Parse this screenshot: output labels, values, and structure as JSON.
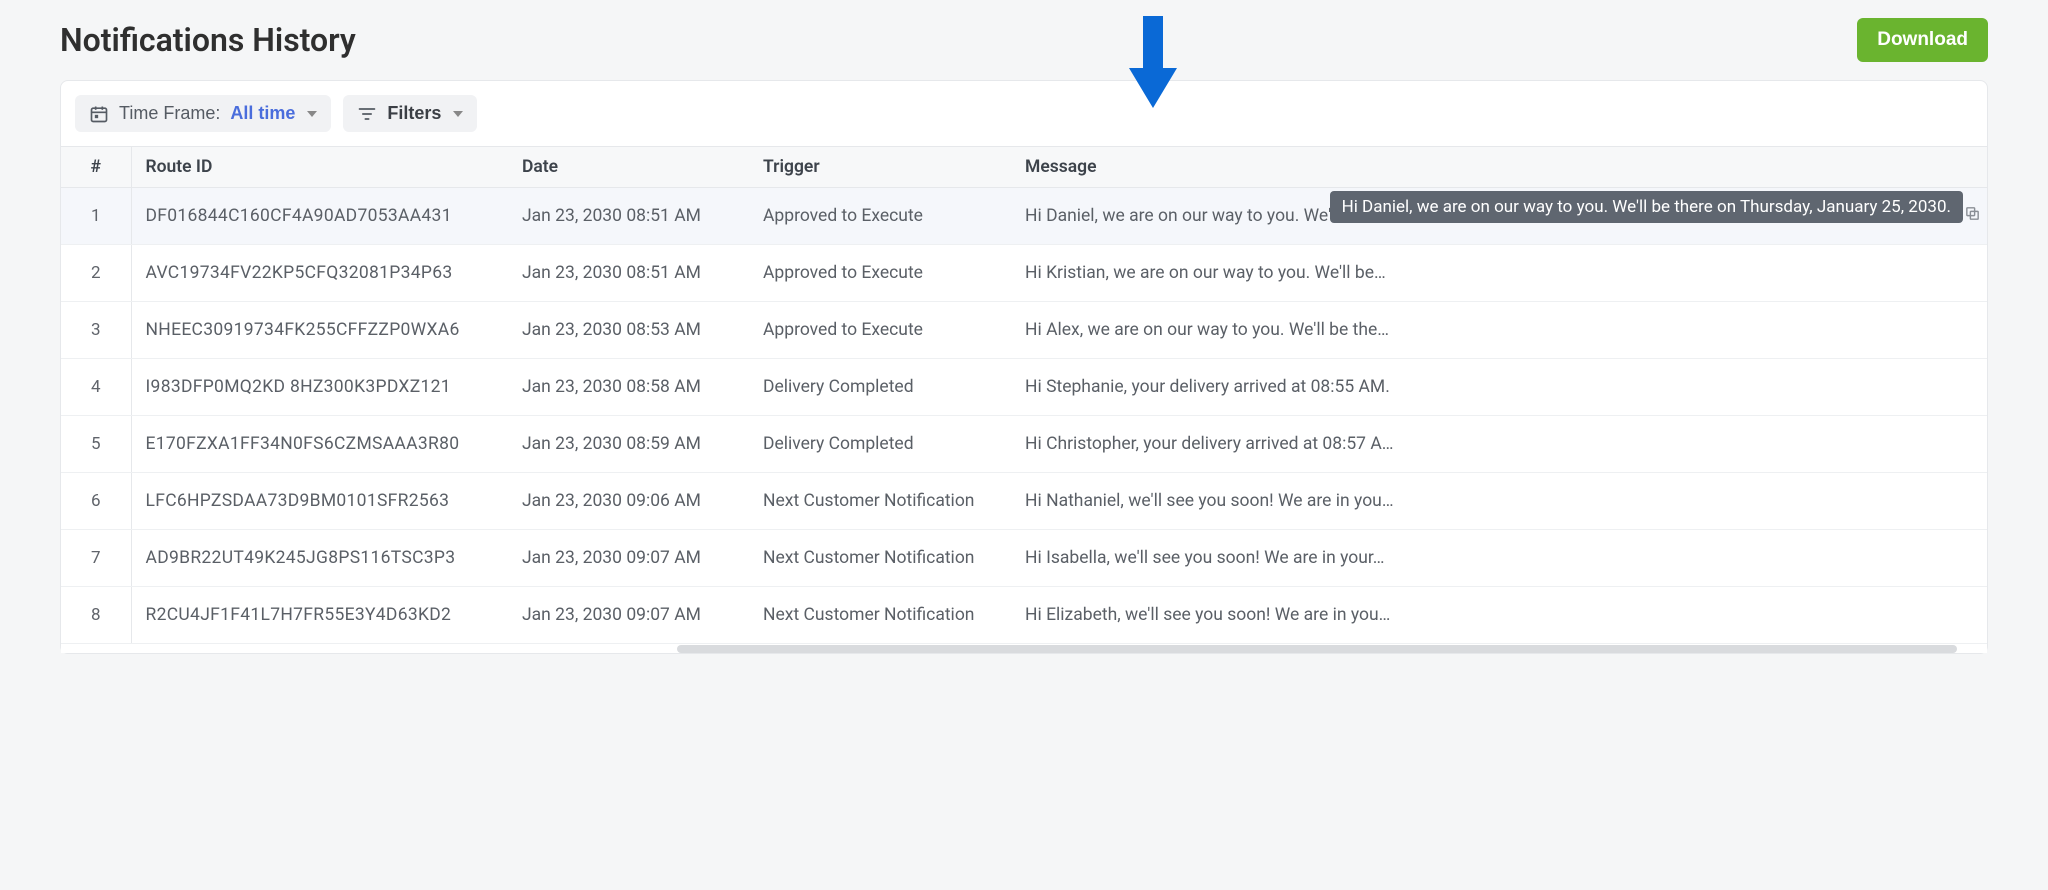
{
  "header": {
    "title": "Notifications History",
    "download_label": "Download"
  },
  "toolbar": {
    "timeframe_label": "Time Frame:",
    "timeframe_value": "All time",
    "filters_label": "Filters"
  },
  "columns": {
    "num": "#",
    "route": "Route ID",
    "date": "Date",
    "trigger": "Trigger",
    "message": "Message"
  },
  "tooltip": "Hi Daniel, we are on our way to you. We'll be there on Thursday, January 25, 2030.",
  "rows": [
    {
      "n": "1",
      "route": "DF016844C160CF4A90AD7053AA431",
      "date": "Jan 23, 2030 08:51 AM",
      "trigger": "Approved to Execute",
      "msg": "Hi Daniel, we are on our way to you. We'll be…"
    },
    {
      "n": "2",
      "route": "AVC19734FV22KP5CFQ32081P34P63",
      "date": "Jan 23, 2030 08:51 AM",
      "trigger": "Approved to Execute",
      "msg": "Hi Kristian, we are on our way to you. We'll be…"
    },
    {
      "n": "3",
      "route": "NHEEC30919734FK255CFFZZP0WXA6",
      "date": "Jan 23, 2030 08:53 AM",
      "trigger": "Approved to Execute",
      "msg": "Hi Alex, we are on our way to you. We'll be the…"
    },
    {
      "n": "4",
      "route": "I983DFP0MQ2KD 8HZ300K3PDXZ121",
      "date": "Jan 23, 2030 08:58 AM",
      "trigger": "Delivery Completed",
      "msg": "Hi Stephanie, your delivery arrived at 08:55 AM."
    },
    {
      "n": "5",
      "route": "E170FZXA1FF34N0FS6CZMSAAA3R80",
      "date": "Jan 23, 2030 08:59 AM",
      "trigger": "Delivery Completed",
      "msg": "Hi Christopher, your delivery arrived at 08:57 A…"
    },
    {
      "n": "6",
      "route": "LFC6HPZSDAA73D9BM0101SFR2563",
      "date": "Jan 23, 2030 09:06 AM",
      "trigger": "Next Customer Notification",
      "msg": "Hi Nathaniel, we'll see you soon! We are in you…"
    },
    {
      "n": "7",
      "route": "AD9BR22UT49K245JG8PS116TSC3P3",
      "date": "Jan 23, 2030 09:07 AM",
      "trigger": "Next Customer Notification",
      "msg": "Hi Isabella, we'll see you soon! We are in your…"
    },
    {
      "n": "8",
      "route": "R2CU4JF1F41L7H7FR55E3Y4D63KD2",
      "date": "Jan 23, 2030 09:07 AM",
      "trigger": "Next Customer Notification",
      "msg": "Hi Elizabeth, we'll see you soon! We are in you…"
    }
  ]
}
